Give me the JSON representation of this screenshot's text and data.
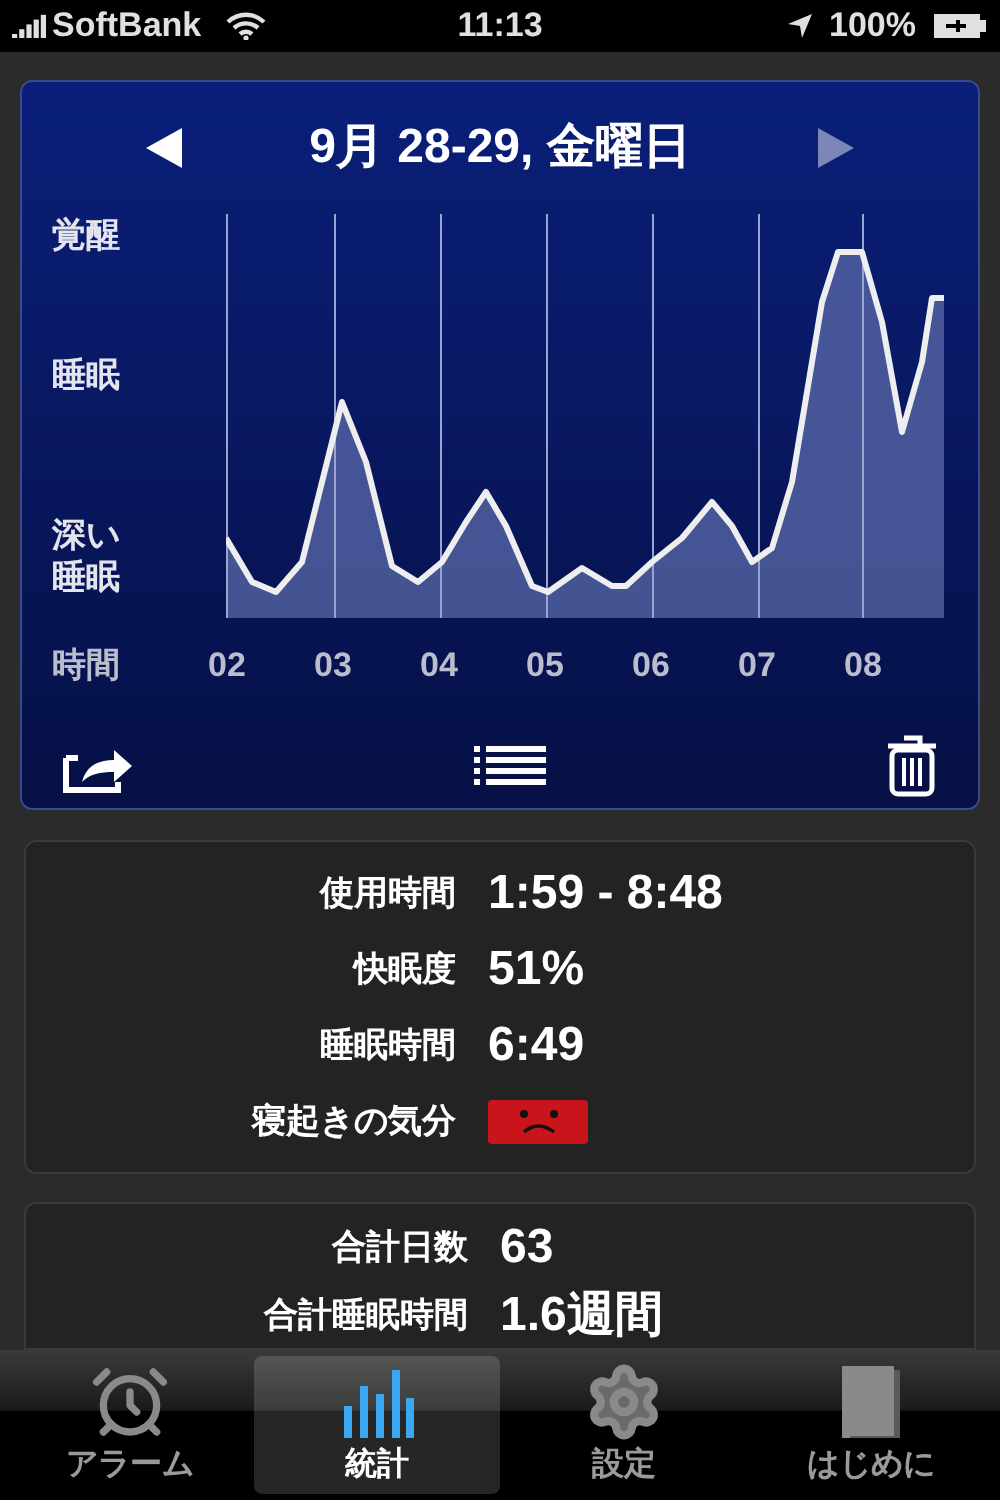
{
  "status_bar": {
    "carrier": "SoftBank",
    "time": "11:13",
    "battery": "100%"
  },
  "header": {
    "title": "9月 28-29, 金曜日"
  },
  "chart": {
    "y_labels": [
      "覚醒",
      "睡眠",
      "深い睡眠"
    ],
    "x_label": "時間",
    "x_ticks": [
      "02",
      "03",
      "04",
      "05",
      "06",
      "07",
      "08"
    ]
  },
  "stats": [
    {
      "kind": "text",
      "label": "使用時間",
      "value": "1:59 - 8:48"
    },
    {
      "kind": "text",
      "label": "快眠度",
      "value": "51%"
    },
    {
      "kind": "text",
      "label": "睡眠時間",
      "value": "6:49"
    },
    {
      "kind": "frown",
      "label": "寝起きの気分"
    }
  ],
  "totals": [
    {
      "label": "合計日数",
      "value": "63"
    },
    {
      "label": "合計睡眠時間",
      "value": "1.6週間"
    }
  ],
  "tabs": [
    {
      "label": "アラーム",
      "kind": "alarm",
      "selected": false
    },
    {
      "label": "統計",
      "kind": "stats",
      "selected": true
    },
    {
      "label": "設定",
      "kind": "gear",
      "selected": false
    },
    {
      "label": "はじめに",
      "kind": "book",
      "selected": false
    }
  ]
}
